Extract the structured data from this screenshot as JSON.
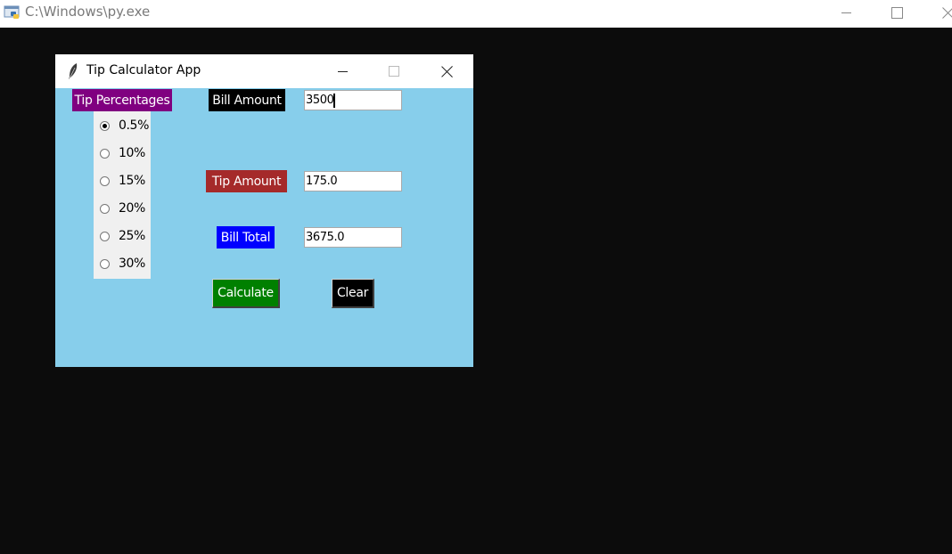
{
  "console": {
    "title": "C:\\Windows\\py.exe",
    "icon": "python-console-icon",
    "background_color": "#0c0c0c"
  },
  "app": {
    "title": "Tip Calculator App",
    "icon": "feather-icon",
    "background_color": "#87ceeb",
    "tip_percentages": {
      "label": "Tip Percentages",
      "label_color": "#800080",
      "options": [
        "0.5%",
        "10%",
        "15%",
        "20%",
        "25%",
        "30%"
      ],
      "selected": "0.5%"
    },
    "bill_amount": {
      "label": "Bill Amount",
      "label_color": "#000000",
      "value": "3500"
    },
    "tip_amount": {
      "label": "Tip  Amount",
      "label_color": "#a52a2a",
      "value": "175.0"
    },
    "bill_total": {
      "label": "Bill Total",
      "label_color": "#0000ff",
      "value": "3675.0"
    },
    "buttons": {
      "calculate_label": "Calculate",
      "calculate_color": "#008000",
      "clear_label": "Clear",
      "clear_color": "#000000"
    }
  }
}
